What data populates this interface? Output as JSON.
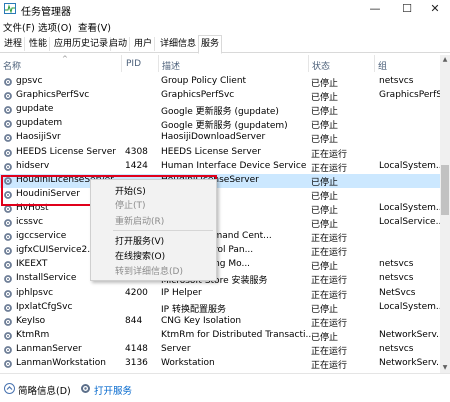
{
  "window": {
    "title": "任务管理器",
    "minimize": "—",
    "maximize": "☐",
    "close": "✕"
  },
  "menubar": [
    "文件(F)",
    "选项(O)",
    "查看(V)"
  ],
  "tabs": [
    {
      "label": "进程"
    },
    {
      "label": "性能"
    },
    {
      "label": "应用历史记录"
    },
    {
      "label": "启动"
    },
    {
      "label": "用户"
    },
    {
      "label": "详细信息"
    },
    {
      "label": "服务",
      "active": true
    }
  ],
  "columns": {
    "name": "名称",
    "pid": "PID",
    "desc": "描述",
    "status": "状态",
    "group": "组"
  },
  "services": [
    {
      "name": "gpsvc",
      "pid": "",
      "desc": "Group Policy Client",
      "status": "已停止",
      "group": "netsvcs"
    },
    {
      "name": "GraphicsPerfSvc",
      "pid": "",
      "desc": "GraphicsPerfSvc",
      "status": "已停止",
      "group": "GraphicsPerfSvc"
    },
    {
      "name": "gupdate",
      "pid": "",
      "desc": "Google 更新服务 (gupdate)",
      "status": "已停止",
      "group": ""
    },
    {
      "name": "gupdatem",
      "pid": "",
      "desc": "Google 更新服务 (gupdatem)",
      "status": "已停止",
      "group": ""
    },
    {
      "name": "HaosijiSvr",
      "pid": "",
      "desc": "HaosijiDownloadServer",
      "status": "已停止",
      "group": ""
    },
    {
      "name": "HEEDS License Server",
      "pid": "4308",
      "desc": "HEEDS License Server",
      "status": "正在运行",
      "group": ""
    },
    {
      "name": "hidserv",
      "pid": "1424",
      "desc": "Human Interface Device Service",
      "status": "正在运行",
      "group": "LocalSystem..."
    },
    {
      "name": "HoudiniLicenseServer",
      "pid": "",
      "desc": "HoudiniLicenseServer",
      "status": "已停止",
      "group": "",
      "selected": true
    },
    {
      "name": "HoudiniServer",
      "pid": "",
      "desc": "",
      "status": "已停止",
      "group": ""
    },
    {
      "name": "HvHost",
      "pid": "",
      "desc": "",
      "status": "已停止",
      "group": "LocalSystem..."
    },
    {
      "name": "icssvc",
      "pid": "",
      "desc": "动热点服务",
      "status": "已停止",
      "group": "LocalService..."
    },
    {
      "name": "igccservice",
      "pid": "",
      "desc": "aphics Command Cent...",
      "status": "正在运行",
      "group": ""
    },
    {
      "name": "igfxCUIService2.0.0.0",
      "pid": "",
      "desc": "aphics Control Pan...",
      "status": "正在运行",
      "group": ""
    },
    {
      "name": "IKEEXT",
      "pid": "",
      "desc": "P IPsec Keying Mo...",
      "status": "已停止",
      "group": "netsvcs"
    },
    {
      "name": "InstallService",
      "pid": "9304",
      "desc": "Microsoft Store 安装服务",
      "status": "正在运行",
      "group": "netsvcs"
    },
    {
      "name": "iphlpsvc",
      "pid": "4200",
      "desc": "IP Helper",
      "status": "正在运行",
      "group": "NetSvcs"
    },
    {
      "name": "IpxlatCfgSvc",
      "pid": "",
      "desc": "IP 转换配置服务",
      "status": "已停止",
      "group": "LocalSystem..."
    },
    {
      "name": "KeyIso",
      "pid": "844",
      "desc": "CNG Key Isolation",
      "status": "正在运行",
      "group": ""
    },
    {
      "name": "KtmRm",
      "pid": "",
      "desc": "KtmRm for Distributed Transacti...",
      "status": "已停止",
      "group": "NetworkServ..."
    },
    {
      "name": "LanmanServer",
      "pid": "4148",
      "desc": "Server",
      "status": "正在运行",
      "group": "netsvcs"
    },
    {
      "name": "LanmanWorkstation",
      "pid": "3136",
      "desc": "Workstation",
      "status": "正在运行",
      "group": "NetworkServ..."
    }
  ],
  "context_menu": [
    {
      "label": "开始(S)",
      "enabled": true
    },
    {
      "label": "停止(T)",
      "enabled": false
    },
    {
      "label": "重新启动(R)",
      "enabled": false
    },
    {
      "label": "打开服务(V)",
      "enabled": true
    },
    {
      "label": "在线搜索(O)",
      "enabled": true
    },
    {
      "label": "转到详细信息(D)",
      "enabled": false
    }
  ],
  "footer": {
    "details": "简略信息(D)",
    "open_services": "打开服务"
  },
  "colors": {
    "selected_row": "#cce8ff",
    "highlight_border": "#e0001b",
    "link": "#0066cc"
  }
}
